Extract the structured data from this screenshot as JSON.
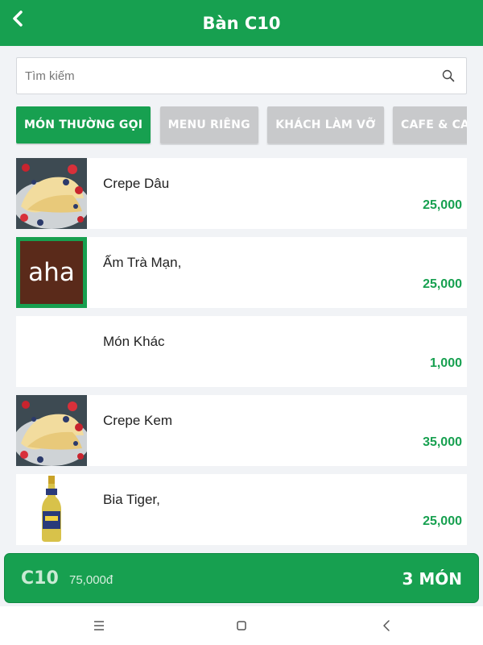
{
  "header": {
    "title": "Bàn C10",
    "back_icon": "chevron-left-icon"
  },
  "search": {
    "placeholder": "Tìm kiếm",
    "value": "",
    "icon": "search-icon"
  },
  "categories": [
    {
      "label": "MÓN THƯỜNG GỌI",
      "active": true
    },
    {
      "label": "MENU RIÊNG",
      "active": false
    },
    {
      "label": "KHÁCH LÀM VỠ",
      "active": false
    },
    {
      "label": "CAFE & CAFE G",
      "active": false
    }
  ],
  "items": [
    {
      "name": "Crepe Dâu",
      "price": "25,000",
      "thumb": "crepe-image"
    },
    {
      "name": "Ấm Trà Mạn,",
      "price": "25,000",
      "thumb": "aha-logo",
      "logo_text": "aha"
    },
    {
      "name": "Món Khác",
      "price": "1,000",
      "thumb": "none"
    },
    {
      "name": "Crepe Kem",
      "price": "35,000",
      "thumb": "crepe-image"
    },
    {
      "name": "Bia Tiger,",
      "price": "25,000",
      "thumb": "beer-bottle-image"
    }
  ],
  "order_bar": {
    "table": "C10",
    "total": "75,000đ",
    "count": "3 MÓN"
  },
  "system_nav": {
    "menu_icon": "menu-icon",
    "home_icon": "home-square-icon",
    "back_icon": "back-chevron-icon"
  },
  "colors": {
    "primary": "#17a050",
    "category_inactive": "#c8c9cb",
    "background": "#f1f3f6",
    "price": "#17a050"
  }
}
